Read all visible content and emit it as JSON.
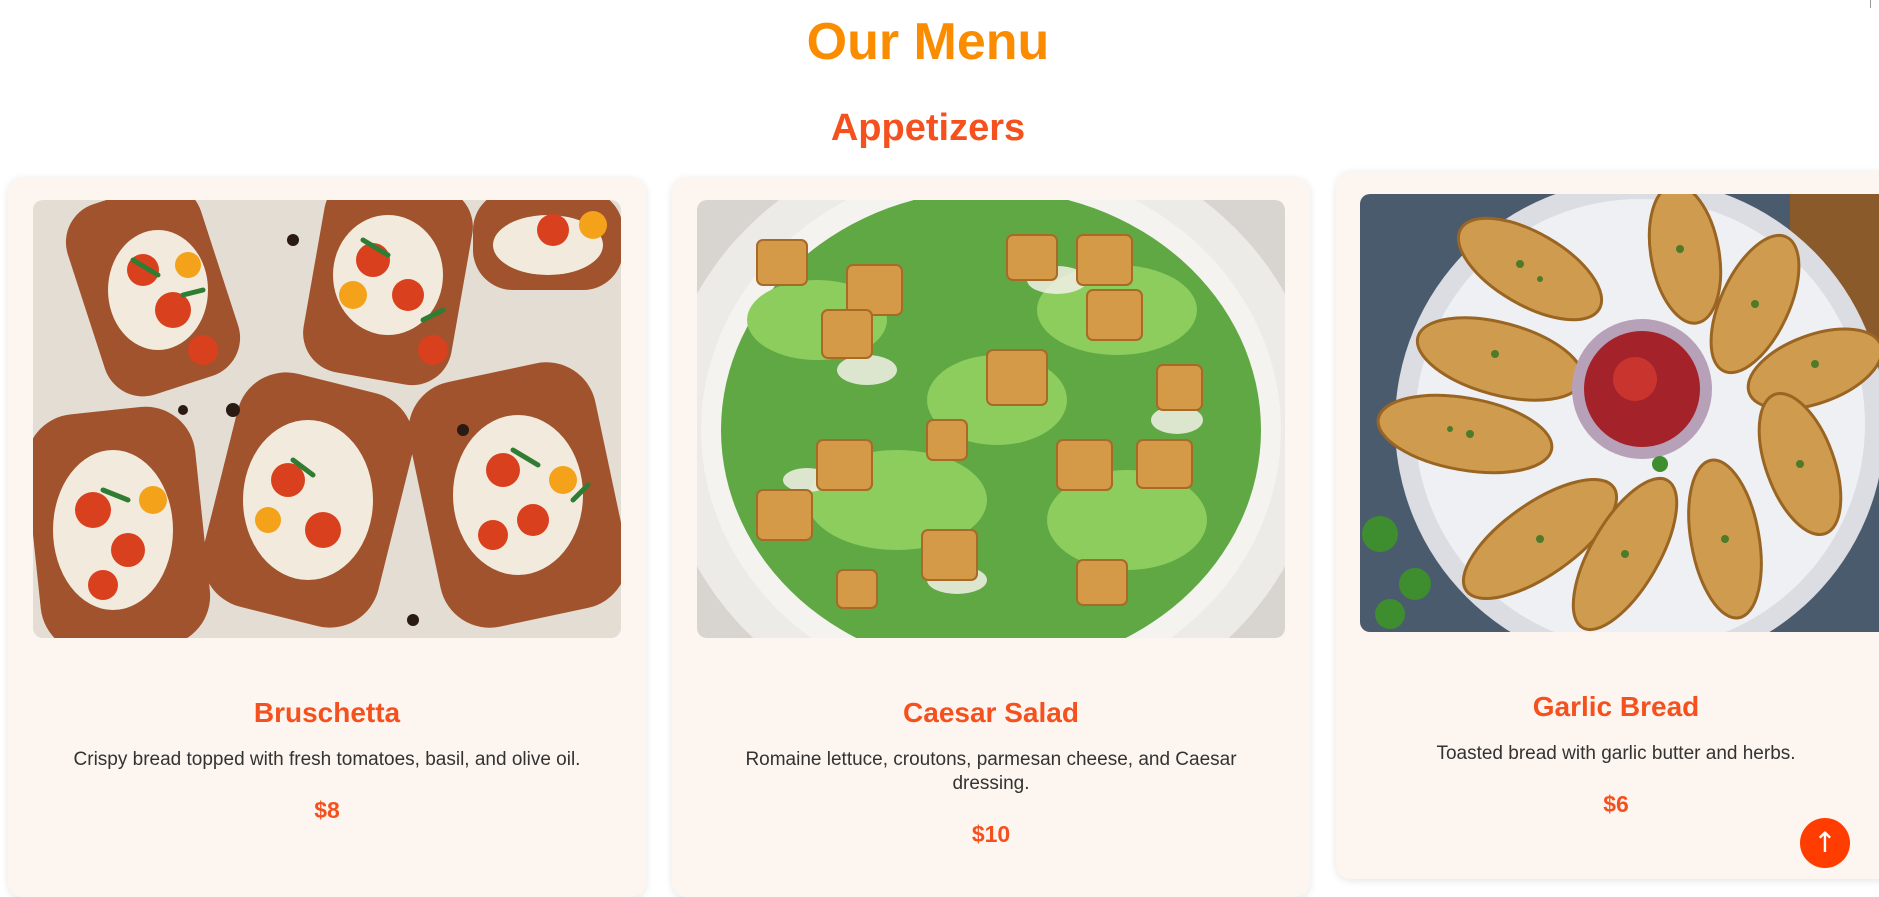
{
  "page": {
    "title": "Our Menu"
  },
  "section": {
    "title": "Appetizers"
  },
  "items": [
    {
      "name": "Bruschetta",
      "description": "Crispy bread topped with fresh tomatoes, basil, and olive oil.",
      "price": "$8"
    },
    {
      "name": "Caesar Salad",
      "description": "Romaine lettuce, croutons, parmesan cheese, and Caesar dressing.",
      "price": "$10"
    },
    {
      "name": "Garlic Bread",
      "description": "Toasted bread with garlic butter and herbs.",
      "price": "$6"
    }
  ],
  "scroll_top": {
    "icon": "arrow-up-icon",
    "glyph": "↑"
  },
  "colors": {
    "accent_title": "#fb8c00",
    "accent": "#f4511e",
    "card_bg": "#fdf5ef",
    "button": "#ff3d00"
  }
}
